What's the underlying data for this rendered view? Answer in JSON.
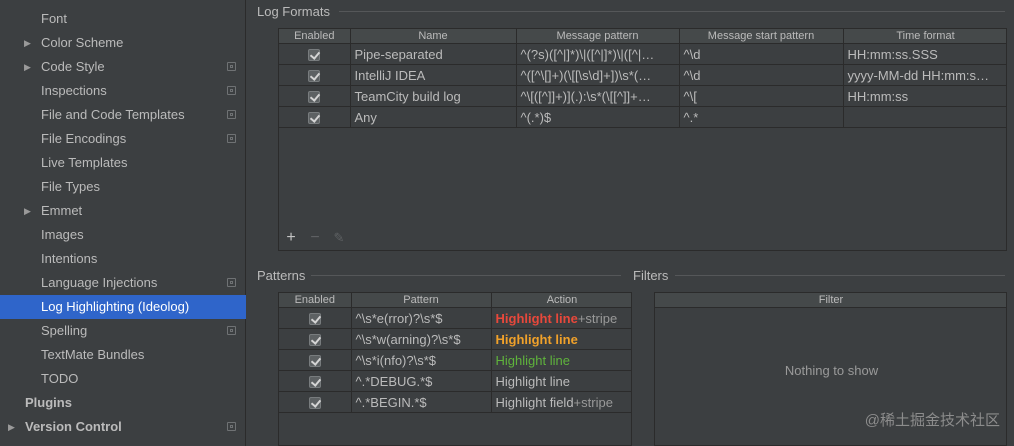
{
  "sidebar": {
    "items": [
      {
        "label": "Font",
        "arrow": false,
        "cfg": false
      },
      {
        "label": "Color Scheme",
        "arrow": true,
        "cfg": false
      },
      {
        "label": "Code Style",
        "arrow": true,
        "cfg": true
      },
      {
        "label": "Inspections",
        "arrow": false,
        "cfg": true
      },
      {
        "label": "File and Code Templates",
        "arrow": false,
        "cfg": true
      },
      {
        "label": "File Encodings",
        "arrow": false,
        "cfg": true
      },
      {
        "label": "Live Templates",
        "arrow": false,
        "cfg": false
      },
      {
        "label": "File Types",
        "arrow": false,
        "cfg": false
      },
      {
        "label": "Emmet",
        "arrow": true,
        "cfg": false
      },
      {
        "label": "Images",
        "arrow": false,
        "cfg": false
      },
      {
        "label": "Intentions",
        "arrow": false,
        "cfg": false
      },
      {
        "label": "Language Injections",
        "arrow": false,
        "cfg": true
      },
      {
        "label": "Log Highlighting (Ideolog)",
        "arrow": false,
        "cfg": false,
        "selected": true
      },
      {
        "label": "Spelling",
        "arrow": false,
        "cfg": true
      },
      {
        "label": "TextMate Bundles",
        "arrow": false,
        "cfg": false
      },
      {
        "label": "TODO",
        "arrow": false,
        "cfg": false
      },
      {
        "label": "Plugins",
        "arrow": false,
        "cfg": false,
        "top": true
      },
      {
        "label": "Version Control",
        "arrow": true,
        "cfg": true,
        "top": true
      }
    ]
  },
  "log_formats": {
    "title": "Log Formats",
    "columns": [
      "Enabled",
      "Name",
      "Message pattern",
      "Message start pattern",
      "Time format"
    ],
    "rows": [
      {
        "enabled": true,
        "name": "Pipe-separated",
        "message_pattern": "^(?s)([^|]*)\\|([^|]*)\\|([^|…",
        "start_pattern": "^\\d",
        "time_format": "HH:mm:ss.SSS"
      },
      {
        "enabled": true,
        "name": "IntelliJ IDEA",
        "message_pattern": "^([^\\[]+)(\\[[\\s\\d]+])\\s*(…",
        "start_pattern": "^\\d",
        "time_format": "yyyy-MM-dd HH:mm:s…"
      },
      {
        "enabled": true,
        "name": "TeamCity build log",
        "message_pattern": "^\\[([^]]+)](.):\\s*(\\[[^]]+…",
        "start_pattern": "^\\[",
        "time_format": "HH:mm:ss"
      },
      {
        "enabled": true,
        "name": "Any",
        "message_pattern": "^(.*)$",
        "start_pattern": "^.*",
        "time_format": ""
      }
    ],
    "toolbar": {
      "add": "+",
      "remove": "−",
      "edit": "✎"
    }
  },
  "patterns": {
    "title": "Patterns",
    "columns": [
      "Enabled",
      "Pattern",
      "Action"
    ],
    "rows": [
      {
        "enabled": true,
        "pattern": "^\\s*e(rror)?\\s*$",
        "action": "Highlight line",
        "extra": "+stripe",
        "color": "#e8483b",
        "bold": true
      },
      {
        "enabled": true,
        "pattern": "^\\s*w(arning)?\\s*$",
        "action": "Highlight line",
        "extra": "",
        "color": "#f0a12a",
        "bold": true
      },
      {
        "enabled": true,
        "pattern": "^\\s*i(nfo)?\\s*$",
        "action": "Highlight line",
        "extra": "",
        "color": "#5fb33c",
        "bold": false
      },
      {
        "enabled": true,
        "pattern": "^.*DEBUG.*$",
        "action": "Highlight line",
        "extra": "",
        "color": "#bbbbbb",
        "bold": false
      },
      {
        "enabled": true,
        "pattern": "^.*BEGIN.*$",
        "action": "Highlight field",
        "extra": "+stripe",
        "color": "#bbbbbb",
        "bold": false
      }
    ]
  },
  "filters": {
    "title": "Filters",
    "columns": [
      "Filter"
    ],
    "empty_text": "Nothing to show"
  },
  "watermark": "@稀土掘金技术社区"
}
